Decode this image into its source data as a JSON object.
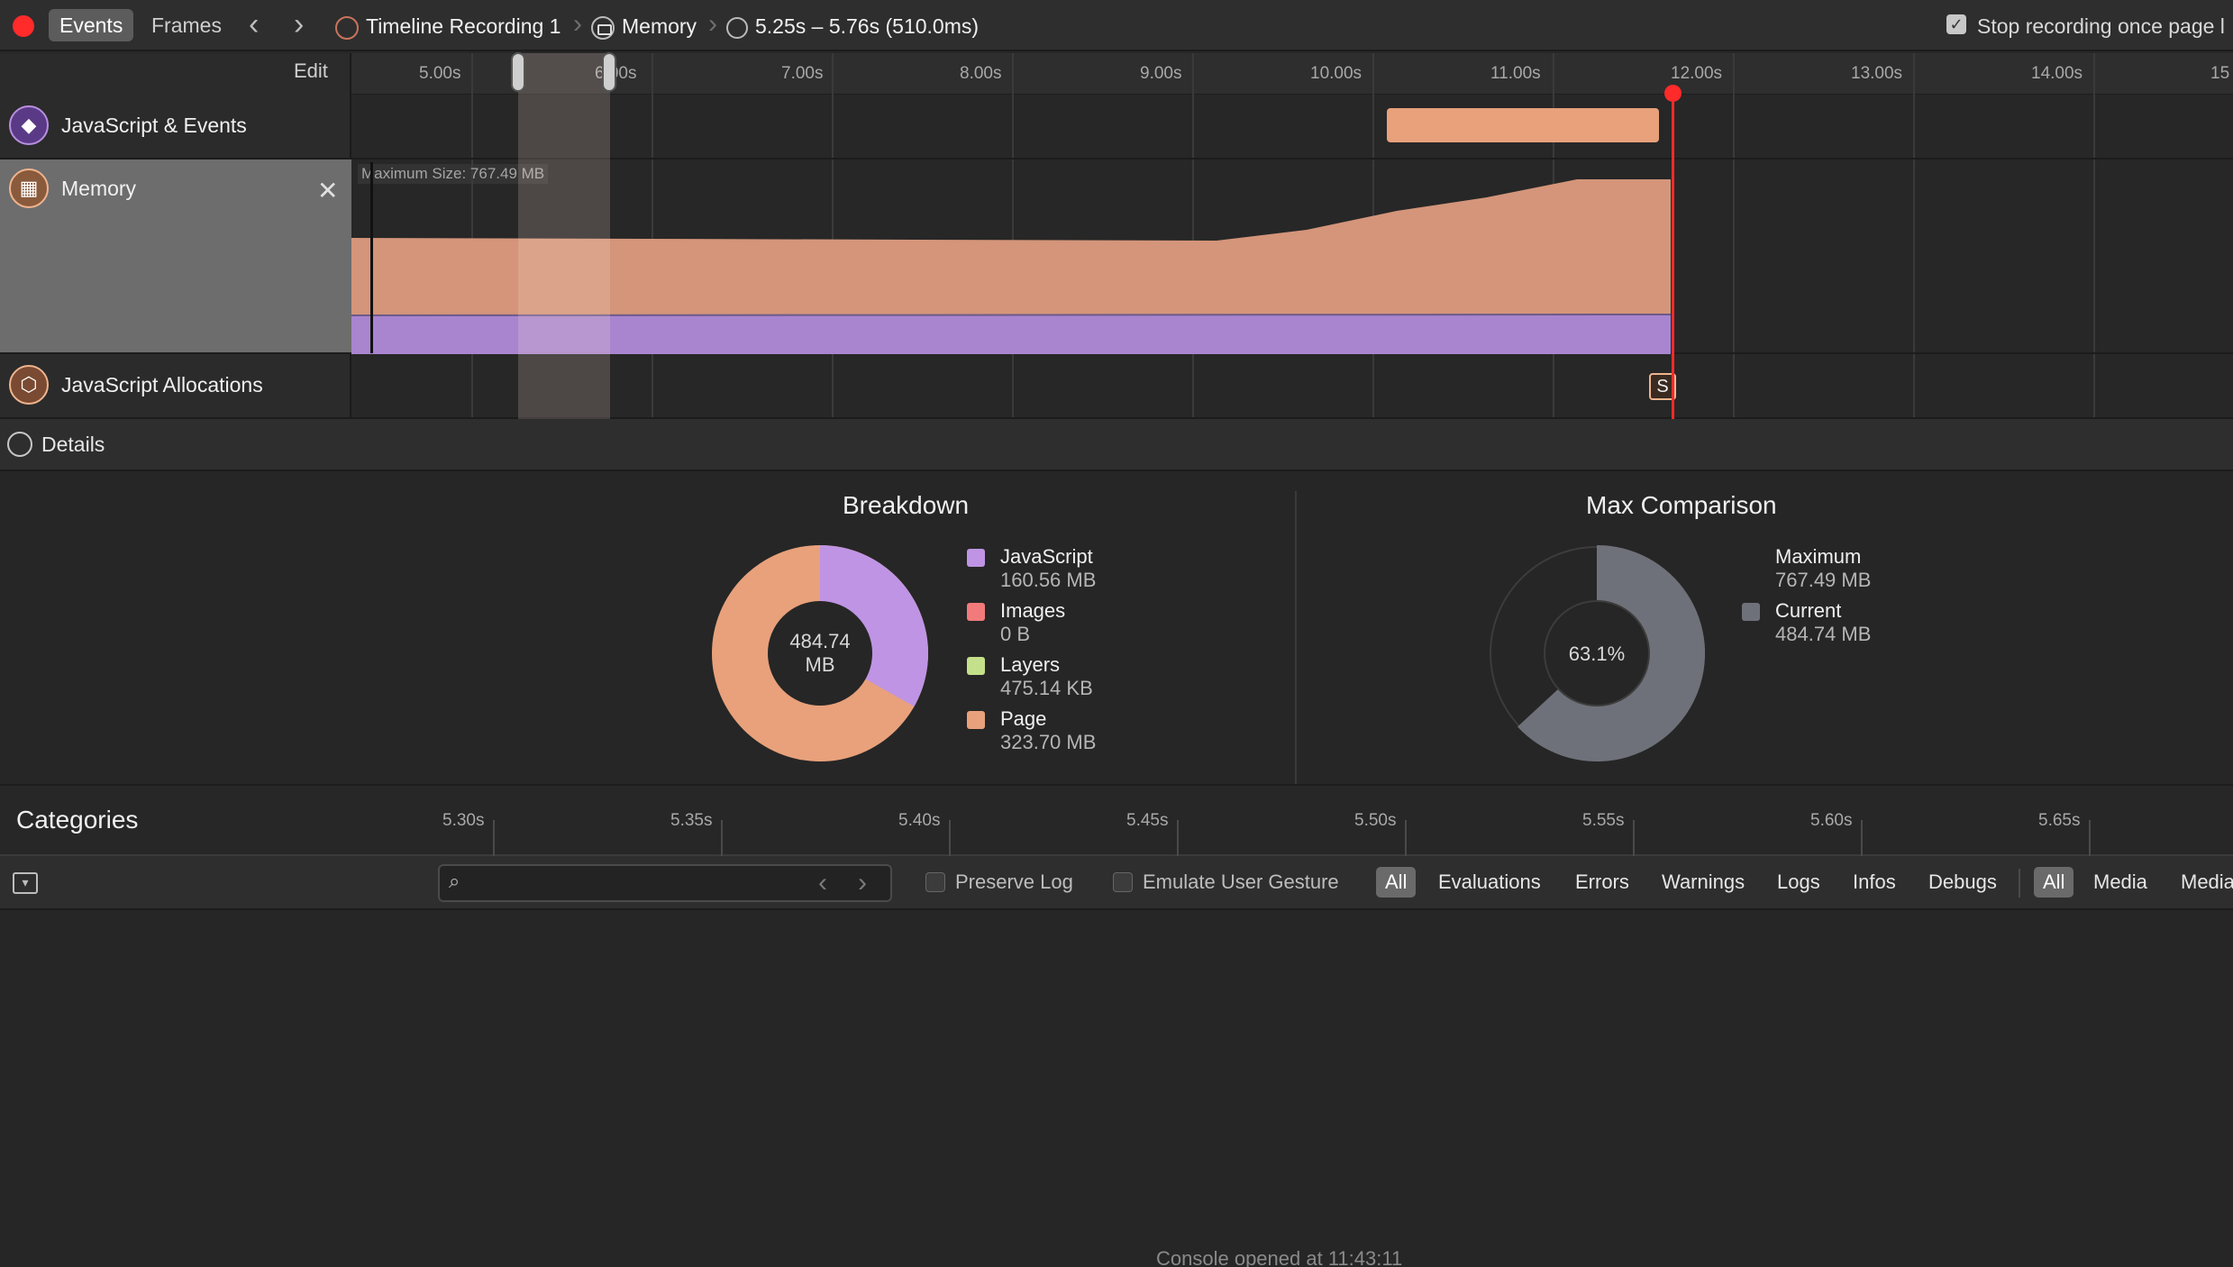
{
  "toolbar": {
    "tabs": [
      {
        "label": "Events"
      },
      {
        "label": "Frames"
      }
    ],
    "breadcrumb": {
      "recording": "Timeline Recording 1",
      "instrument": "Memory",
      "range": "5.25s – 5.76s (510.0ms)"
    },
    "stop_recording_label": "Stop recording once page l"
  },
  "timeline": {
    "edit_label": "Edit",
    "ticks": [
      "5.00s",
      "6.00s",
      "7.00s",
      "8.00s",
      "9.00s",
      "10.00s",
      "11.00s",
      "12.00s",
      "13.00s",
      "14.00s",
      "15"
    ],
    "tracks": {
      "js_events": "JavaScript & Events",
      "memory": "Memory",
      "js_allocations": "JavaScript Allocations"
    },
    "max_size_label": "Maximum Size: 767.49 MB",
    "snapshot_marker": "S"
  },
  "details": {
    "label": "Details",
    "breakdown": {
      "title": "Breakdown",
      "center_value": "484.74",
      "center_unit": "MB",
      "items": [
        {
          "name": "JavaScript",
          "value": "160.56 MB",
          "color": "#bf94e4"
        },
        {
          "name": "Images",
          "value": "0 B",
          "color": "#f27a7a"
        },
        {
          "name": "Layers",
          "value": "475.14 KB",
          "color": "#c4e08a"
        },
        {
          "name": "Page",
          "value": "323.70 MB",
          "color": "#e8a17b"
        }
      ]
    },
    "max_comparison": {
      "title": "Max Comparison",
      "center_value": "63.1%",
      "items": [
        {
          "name": "Maximum",
          "value": "767.49 MB"
        },
        {
          "name": "Current",
          "value": "484.74 MB",
          "color": "#6e7179"
        }
      ]
    },
    "categories": {
      "title": "Categories",
      "ticks": [
        "5.30s",
        "5.35s",
        "5.40s",
        "5.45s",
        "5.50s",
        "5.55s",
        "5.60s",
        "5.65s"
      ]
    }
  },
  "console": {
    "preserve_log": "Preserve Log",
    "emulate_gesture": "Emulate User Gesture",
    "filters": [
      "All",
      "Evaluations",
      "Errors",
      "Warnings",
      "Logs",
      "Infos",
      "Debugs"
    ],
    "sources": [
      "All",
      "Media",
      "Media"
    ],
    "opened_message": "Console opened at 11:43:11"
  }
}
